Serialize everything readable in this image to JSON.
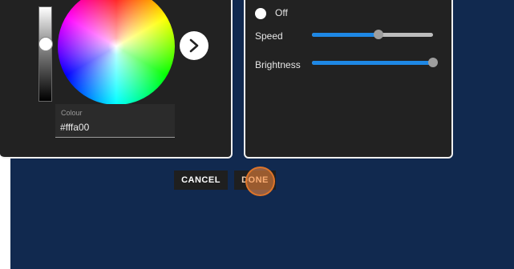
{
  "colour_picker": {
    "colour_label": "Colour",
    "colour_value": "#fffa00",
    "next_icon": "chevron-right-icon"
  },
  "mode": {
    "off_label": "Off"
  },
  "sliders": {
    "speed": {
      "label": "Speed",
      "value_percent": 55
    },
    "brightness": {
      "label": "Brightness",
      "value_percent": 100
    }
  },
  "actions": {
    "cancel_label": "CANCEL",
    "done_label": "DONE"
  },
  "colors": {
    "backdrop": "#11294f",
    "panel": "#222222",
    "slider_fill": "#1e88e5",
    "button_highlight": "#ff8c3c"
  }
}
